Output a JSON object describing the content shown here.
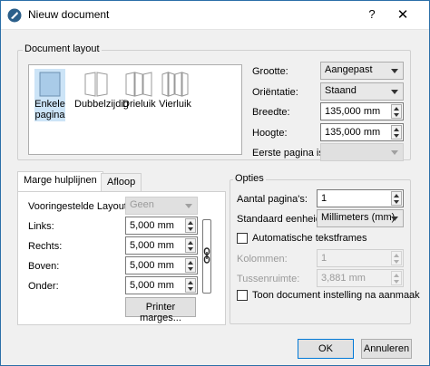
{
  "window": {
    "title": "Nieuw document",
    "help_label": "?",
    "close_label": "✕"
  },
  "document_layout": {
    "group_label": "Document layout",
    "layouts": [
      {
        "label": "Enkele pagina",
        "selected": true
      },
      {
        "label": "Dubbelzijdig",
        "selected": false
      },
      {
        "label": "Drieluik",
        "selected": false
      },
      {
        "label": "Vierluik",
        "selected": false
      }
    ],
    "size_label": "Grootte:",
    "size_value": "Aangepast",
    "orientation_label": "Oriëntatie:",
    "orientation_value": "Staand",
    "width_label": "Breedte:",
    "width_value": "135,000 mm",
    "height_label": "Hoogte:",
    "height_value": "135,000 mm",
    "first_page_label": "Eerste pagina is:",
    "first_page_value": ""
  },
  "tabs": [
    {
      "label": "Marge hulplijnen",
      "active": true
    },
    {
      "label": "Afloop",
      "active": false
    }
  ],
  "margins": {
    "preset_label": "Vooringestelde Layouts:",
    "preset_value": "Geen",
    "left_label": "Links:",
    "left_value": "5,000 mm",
    "right_label": "Rechts:",
    "right_value": "5,000 mm",
    "top_label": "Boven:",
    "top_value": "5,000 mm",
    "bottom_label": "Onder:",
    "bottom_value": "5,000 mm",
    "printer_button": "Printer marges..."
  },
  "options": {
    "group_label": "Opties",
    "pages_label": "Aantal pagina's:",
    "pages_value": "1",
    "unit_label": "Standaard eenheid:",
    "unit_value": "Millimeters (mm)",
    "auto_frames_label": "Automatische tekstframes",
    "auto_frames_checked": false,
    "columns_label": "Kolommen:",
    "columns_value": "1",
    "gap_label": "Tussenruimte:",
    "gap_value": "3,881 mm",
    "show_settings_label": "Toon document instelling na aanmaak",
    "show_settings_checked": false
  },
  "footer": {
    "ok_label": "OK",
    "cancel_label": "Annuleren"
  },
  "colors": {
    "accent": "#0078d7",
    "selection": "#cce4f7",
    "page_fill": "#a9cbe8"
  }
}
